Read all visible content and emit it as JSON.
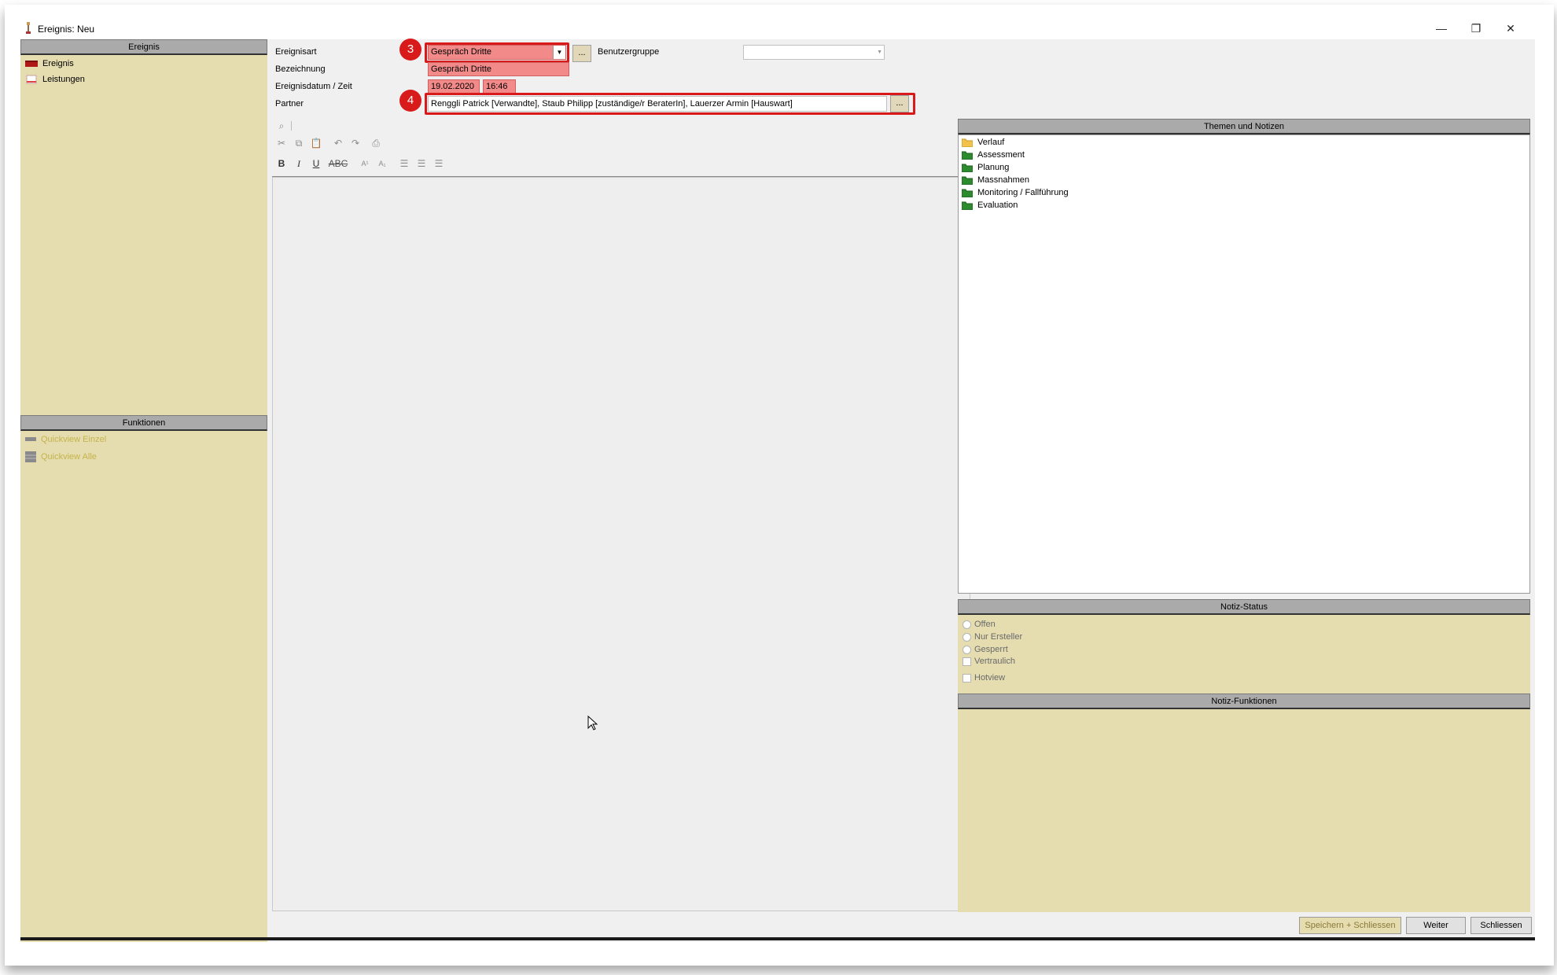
{
  "window": {
    "title": "Ereignis: Neu",
    "minimize": "—",
    "restore": "❐",
    "close": "✕"
  },
  "left": {
    "header": "Ereignis",
    "items": [
      {
        "label": "Ereignis",
        "icon": "event-icon"
      },
      {
        "label": "Leistungen",
        "icon": "services-icon"
      }
    ],
    "functions_header": "Funktionen",
    "functions": [
      {
        "label": "Quickview Einzel",
        "icon": "quickview-single-icon"
      },
      {
        "label": "Quickview Alle",
        "icon": "quickview-all-icon"
      }
    ]
  },
  "form": {
    "ereignisart_label": "Ereignisart",
    "ereignisart_value": "Gespräch Dritte",
    "benutzergruppe_label": "Benutzergruppe",
    "benutzergruppe_value": "",
    "bezeichnung_label": "Bezeichnung",
    "bezeichnung_value": "Gespräch Dritte",
    "datum_label": "Ereignisdatum / Zeit",
    "datum_value": "19.02.2020",
    "zeit_value": "16:46",
    "partner_label": "Partner",
    "partner_value": "Renggli Patrick [Verwandte], Staub Philipp [zuständige/r BeraterIn], Lauerzer Armin [Hauswart]",
    "dots": "...",
    "badge_3": "3",
    "badge_4": "4"
  },
  "editor": {
    "bold": "B",
    "italic": "I",
    "underline": "U",
    "strike": "ABC",
    "superscript": "A¹",
    "subscript": "A₁"
  },
  "themes": {
    "header": "Themen und Notizen",
    "items": [
      {
        "label": "Verlauf",
        "icon": "folder-open-icon"
      },
      {
        "label": "Assessment",
        "icon": "folder-icon"
      },
      {
        "label": "Planung",
        "icon": "folder-icon"
      },
      {
        "label": "Massnahmen",
        "icon": "folder-icon"
      },
      {
        "label": "Monitoring / Fallführung",
        "icon": "folder-icon"
      },
      {
        "label": "Evaluation",
        "icon": "folder-icon"
      }
    ]
  },
  "status": {
    "header": "Notiz-Status",
    "options": [
      "Offen",
      "Nur Ersteller",
      "Gesperrt"
    ],
    "checks": [
      "Vertraulich",
      "Hotview"
    ]
  },
  "functions_right": {
    "header": "Notiz-Funktionen"
  },
  "buttons": {
    "save_close": "Speichern + Schliessen",
    "next": "Weiter",
    "close": "Schliessen"
  },
  "colors": {
    "beige": "#e5dcb0",
    "required": "#f28a8a",
    "highlight": "#d81a1a"
  }
}
